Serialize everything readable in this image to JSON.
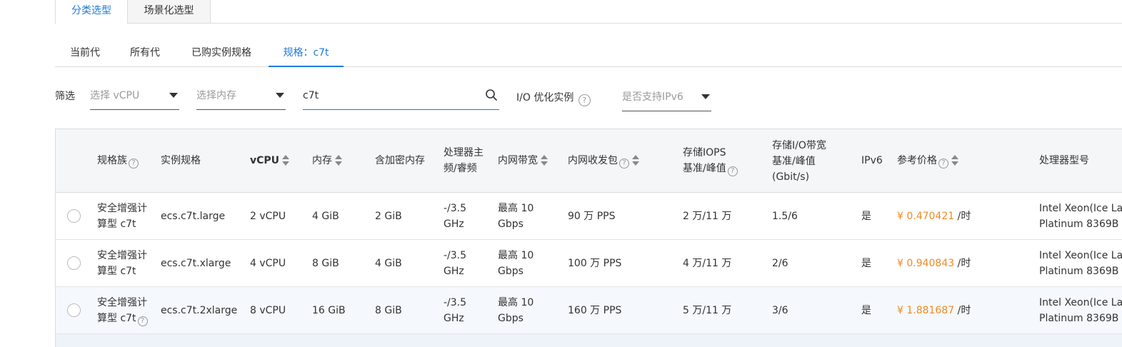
{
  "top_tabs": [
    "分类选型",
    "场景化选型"
  ],
  "sub_tabs": [
    "当前代",
    "所有代",
    "已购实例规格",
    "规格：c7t"
  ],
  "filters": {
    "label": "筛选",
    "vcpu_placeholder": "选择 vCPU",
    "memory_placeholder": "选择内存",
    "search_value": "c7t",
    "io_label": "I/O 优化实例",
    "ipv6_placeholder": "是否支持IPv6"
  },
  "table": {
    "headers": {
      "family": "规格族",
      "spec": "实例规格",
      "vcpu": "vCPU",
      "memory": "内存",
      "enc_memory": "含加密内存",
      "freq_line1": "处理器主",
      "freq_line2": "频/睿频",
      "bandwidth": "内网带宽",
      "pps": "内网收发包",
      "iops_line1": "存储IOPS",
      "iops_line2": "基准/峰值",
      "io_bw_line1": "存储I/O带宽",
      "io_bw_line2": "基准/峰值",
      "io_bw_line3": "(Gbit/s)",
      "ipv6": "IPv6",
      "price": "参考价格",
      "cpu_model": "处理器型号"
    },
    "rows": [
      {
        "family_l1": "安全增强计",
        "family_l2": "算型 c7t",
        "spec": "ecs.c7t.large",
        "vcpu": "2 vCPU",
        "memory": "4 GiB",
        "enc_memory": "2 GiB",
        "freq_l1": "-/3.5",
        "freq_l2": "GHz",
        "bw_l1": "最高 10",
        "bw_l2": "Gbps",
        "pps": "90 万 PPS",
        "iops": "2 万/11 万",
        "io_bw": "1.5/6",
        "ipv6": "是",
        "price": "¥ 0.470421",
        "price_unit": "/时",
        "cpu_l1": "Intel Xeon(Ice Lake)",
        "cpu_l2": "Platinum 8369B"
      },
      {
        "family_l1": "安全增强计",
        "family_l2": "算型 c7t",
        "spec": "ecs.c7t.xlarge",
        "vcpu": "4 vCPU",
        "memory": "8 GiB",
        "enc_memory": "4 GiB",
        "freq_l1": "-/3.5",
        "freq_l2": "GHz",
        "bw_l1": "最高 10",
        "bw_l2": "Gbps",
        "pps": "100 万 PPS",
        "iops": "4 万/11 万",
        "io_bw": "2/6",
        "ipv6": "是",
        "price": "¥ 0.940843",
        "price_unit": "/时",
        "cpu_l1": "Intel Xeon(Ice Lake)",
        "cpu_l2": "Platinum 8369B"
      },
      {
        "family_l1": "安全增强计",
        "family_l2": "算型 c7t",
        "spec": "ecs.c7t.2xlarge",
        "vcpu": "8 vCPU",
        "memory": "16 GiB",
        "enc_memory": "8 GiB",
        "freq_l1": "-/3.5",
        "freq_l2": "GHz",
        "bw_l1": "最高 10",
        "bw_l2": "Gbps",
        "pps": "160 万 PPS",
        "iops": "5 万/11 万",
        "io_bw": "3/6",
        "ipv6": "是",
        "price": "¥ 1.881687",
        "price_unit": "/时",
        "cpu_l1": "Intel Xeon(Ice Lake)",
        "cpu_l2": "Platinum 8369B"
      }
    ]
  },
  "colors": {
    "accent": "#1d7ad9",
    "price": "#f08a24"
  }
}
